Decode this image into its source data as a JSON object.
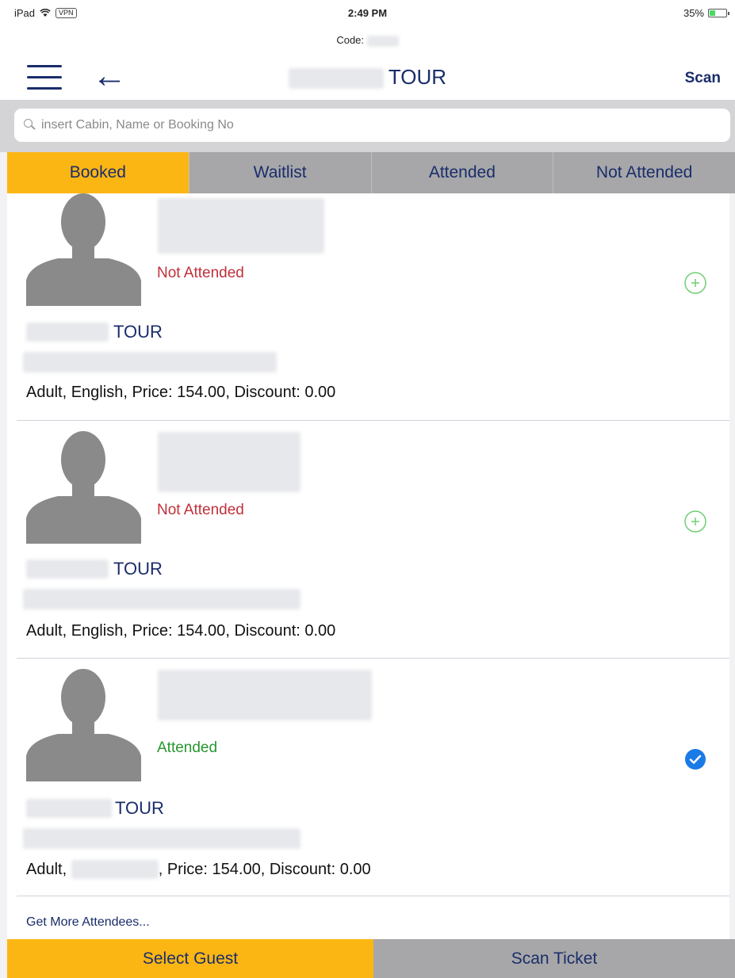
{
  "status_bar": {
    "device": "iPad",
    "vpn": "VPN",
    "time": "2:49 PM",
    "battery": "35%",
    "battery_level": 0.35
  },
  "header": {
    "code_label": "Code:",
    "title": "TOUR",
    "scan_label": "Scan"
  },
  "search": {
    "placeholder": "insert Cabin, Name or Booking No"
  },
  "tabs": [
    {
      "label": "Booked",
      "active": true
    },
    {
      "label": "Waitlist",
      "active": false
    },
    {
      "label": "Attended",
      "active": false
    },
    {
      "label": "Not Attended",
      "active": false
    }
  ],
  "attendees": [
    {
      "status": "Not Attended",
      "tour": "TOUR",
      "type": "Adult",
      "language": "English",
      "price_label": "Price: 154.00",
      "discount_label": "Discount: 0.00",
      "action_icon": "add-circle-icon"
    },
    {
      "status": "Not Attended",
      "tour": "TOUR",
      "type": "Adult",
      "language": "English",
      "price_label": "Price: 154.00",
      "discount_label": "Discount: 0.00",
      "action_icon": "add-circle-icon"
    },
    {
      "status": "Attended",
      "tour": "TOUR",
      "type": "Adult",
      "language": "",
      "price_label": "Price: 154.00",
      "discount_label": "Discount: 0.00",
      "action_icon": "checkmark-circle-icon"
    }
  ],
  "more_link": "Get More Attendees...",
  "bottom": {
    "select_label": "Select Guest",
    "scan_label": "Scan Ticket"
  },
  "colors": {
    "accent": "#fcb614",
    "navy": "#1a2d6b",
    "not_attended": "#c0303b",
    "attended": "#27962f",
    "check": "#1a7be6"
  }
}
